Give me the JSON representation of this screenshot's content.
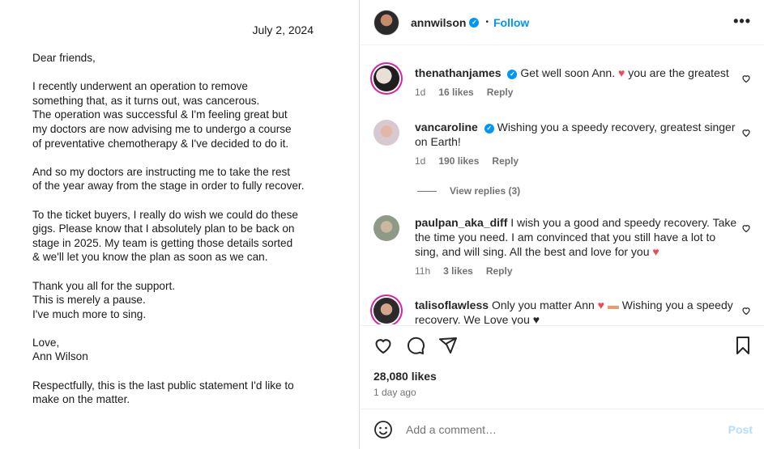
{
  "letter": {
    "date": "July 2, 2024",
    "paragraphs": [
      "Dear friends,",
      "I recently underwent an operation to remove\nsomething that, as it turns out, was cancerous.\nThe operation was successful & I'm feeling great but\nmy doctors are now advising me to undergo a course\nof preventative chemotherapy & I've decided to do it.",
      "And so my doctors are instructing me to take the rest\nof the year away from the stage in order to fully recover.",
      "To the ticket buyers, I really do wish we could do these\ngigs. Please know that I absolutely plan to be back on\nstage in 2025. My team is getting those details sorted\n& we'll let you know the plan as soon as we can.",
      "Thank you all for the support.\nThis is merely a pause.\nI've much more to sing.",
      "Love,\nAnn Wilson",
      "Respectfully, this is the last public statement I'd like to\nmake on the matter."
    ]
  },
  "header": {
    "username": "annwilson",
    "dot": "•",
    "follow_label": "Follow",
    "more_label": "•••"
  },
  "comments": [
    {
      "user": "thenathanjames",
      "verified": true,
      "text_before": "Get well soon Ann.",
      "emoji": "♥",
      "text_after": "you are the greatest",
      "age": "1d",
      "likes": "16 likes",
      "reply": "Reply"
    },
    {
      "user": "vancaroline",
      "verified": true,
      "text": "Wishing you a speedy recovery, greatest singer on Earth!",
      "age": "1d",
      "likes": "190 likes",
      "reply": "Reply"
    },
    {
      "user": "paulpan_aka_diff",
      "verified": false,
      "text": "I wish you a good and speedy recovery. Take the time you need. I am convinced that you still have a lot to sing, and will sing. All the best and love for you",
      "emoji": "♥",
      "age": "11h",
      "likes": "3 likes",
      "reply": "Reply"
    },
    {
      "user": "talisoflawless",
      "verified": false,
      "text_before": "Only you matter Ann",
      "emoji": "♥",
      "text_after": "Wishing you a speedy recovery. We Love you ♥"
    }
  ],
  "view_replies": "View replies (3)",
  "post": {
    "likes": "28,080 likes",
    "time": "1 day ago"
  },
  "composer": {
    "placeholder": "Add a comment…",
    "post_label": "Post"
  },
  "icons": {
    "like": "heart-icon",
    "comment": "comment-icon",
    "share": "send-icon",
    "save": "bookmark-icon",
    "emoji": "emoji-icon",
    "verified": "verified-badge-icon"
  },
  "colors": {
    "accent": "#0095f6",
    "heart": "#ed4956",
    "post_disabled": "#b2dffc"
  }
}
